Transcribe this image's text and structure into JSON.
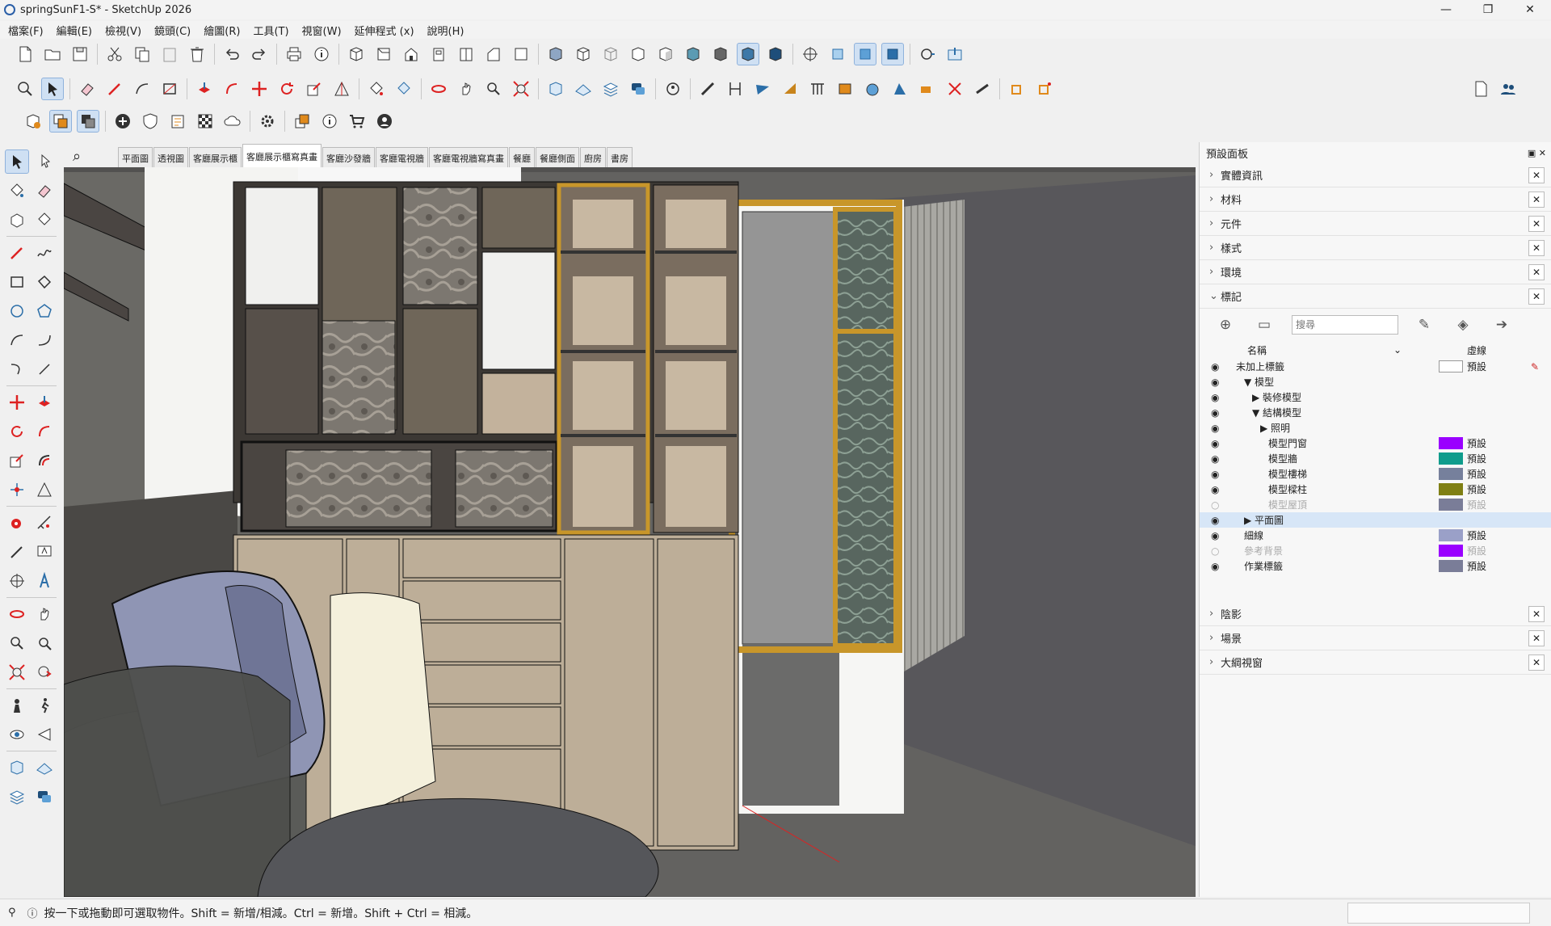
{
  "window": {
    "title": "springSunF1-S* - SketchUp 2026",
    "minimize": "—",
    "maximize": "❐",
    "close": "✕"
  },
  "menu": [
    "檔案(F)",
    "編輯(E)",
    "檢視(V)",
    "鏡頭(C)",
    "繪圖(R)",
    "工具(T)",
    "視窗(W)",
    "延伸程式 (x)",
    "說明(H)"
  ],
  "scenes": {
    "search": "⌕",
    "tabs": [
      "平面圖",
      "透視圖",
      "客廳展示櫃",
      "客廳展示櫃寫真畫",
      "客廳沙發牆",
      "客廳電視牆",
      "客廳電視牆寫真畫",
      "餐廳",
      "餐廳側面",
      "廚房",
      "書房"
    ],
    "selected": 3
  },
  "status": {
    "text": "按一下或拖動即可選取物件。Shift = 新增/相減。Ctrl = 新增。Shift + Ctrl = 相減。"
  },
  "tray": {
    "title": "預設面板",
    "panels_top": [
      "實體資訊",
      "材料",
      "元件",
      "樣式",
      "環境"
    ],
    "tags_panel": "標記",
    "search_placeholder": "搜尋",
    "col_name": "名稱",
    "col_dash": "虛線",
    "rows": [
      {
        "name": "未加上標籤",
        "indent": 0,
        "dash": "預設",
        "color": "#ffffff",
        "visible": true,
        "arrow": ""
      },
      {
        "name": "模型",
        "indent": 1,
        "dash": "",
        "color": "",
        "visible": true,
        "arrow": "▼"
      },
      {
        "name": "裝修模型",
        "indent": 2,
        "dash": "",
        "color": "",
        "visible": true,
        "arrow": "▶"
      },
      {
        "name": "結構模型",
        "indent": 2,
        "dash": "",
        "color": "",
        "visible": true,
        "arrow": "▼"
      },
      {
        "name": "照明",
        "indent": 3,
        "dash": "",
        "color": "",
        "visible": true,
        "arrow": "▶"
      },
      {
        "name": "模型門窗",
        "indent": 4,
        "dash": "預設",
        "color": "#9a00ff",
        "visible": true,
        "arrow": ""
      },
      {
        "name": "模型牆",
        "indent": 4,
        "dash": "預設",
        "color": "#0f9c8c",
        "visible": true,
        "arrow": ""
      },
      {
        "name": "模型樓梯",
        "indent": 4,
        "dash": "預設",
        "color": "#76809c",
        "visible": true,
        "arrow": ""
      },
      {
        "name": "模型樑柱",
        "indent": 4,
        "dash": "預設",
        "color": "#7f7f14",
        "visible": true,
        "arrow": ""
      },
      {
        "name": "模型屋頂",
        "indent": 4,
        "dash": "預設",
        "color": "#7a7d98",
        "visible": false,
        "arrow": ""
      },
      {
        "name": "平面圖",
        "indent": 1,
        "dash": "",
        "color": "",
        "visible": true,
        "arrow": "▶"
      },
      {
        "name": "細線",
        "indent": 1,
        "dash": "預設",
        "color": "#9aa0c8",
        "visible": true,
        "arrow": ""
      },
      {
        "name": "參考背景",
        "indent": 1,
        "dash": "預設",
        "color": "#9a00ff",
        "visible": false,
        "arrow": ""
      },
      {
        "name": "作業標籤",
        "indent": 1,
        "dash": "預設",
        "color": "#7a7d98",
        "visible": true,
        "arrow": ""
      }
    ],
    "panels_bottom": [
      "陰影",
      "場景",
      "大綱視窗"
    ]
  }
}
